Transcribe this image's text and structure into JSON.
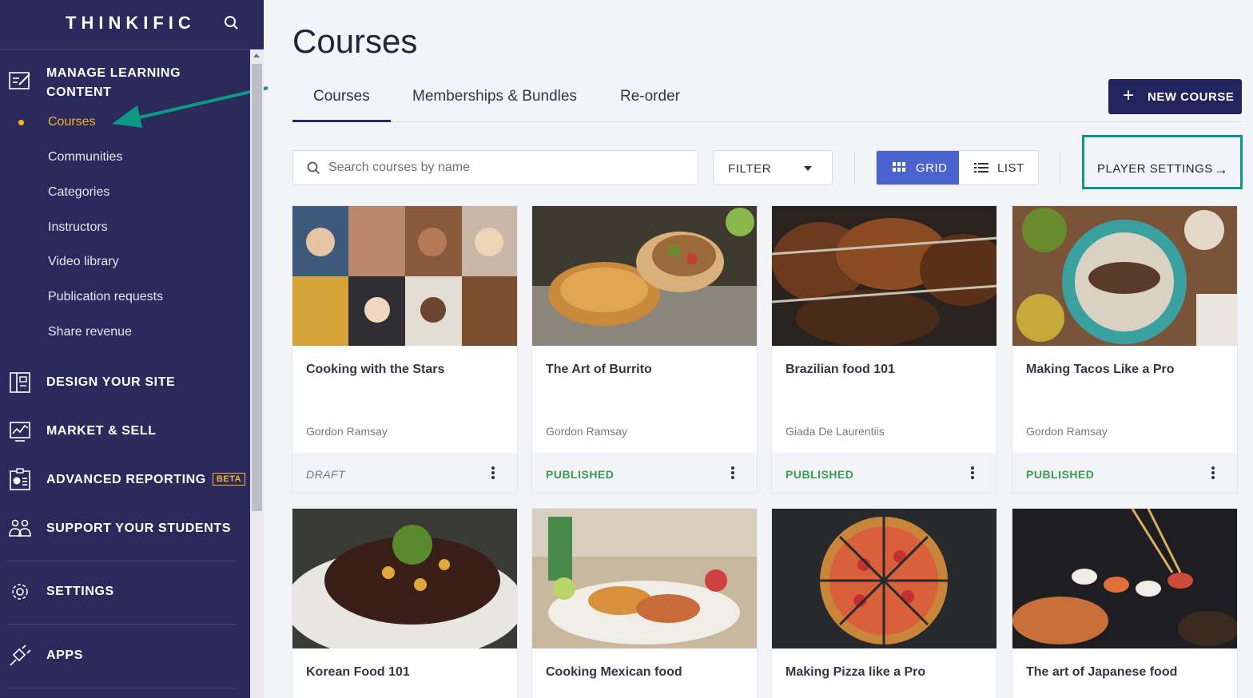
{
  "app": {
    "logo": "THINKIFIC"
  },
  "sidebar": {
    "manage_label": "MANAGE LEARNING CONTENT",
    "sub_items": [
      {
        "label": "Courses",
        "active": true
      },
      {
        "label": "Communities"
      },
      {
        "label": "Categories"
      },
      {
        "label": "Instructors"
      },
      {
        "label": "Video library"
      },
      {
        "label": "Publication requests"
      },
      {
        "label": "Share revenue"
      }
    ],
    "sections": [
      {
        "label": "DESIGN YOUR SITE",
        "icon": "layout-icon"
      },
      {
        "label": "MARKET & SELL",
        "icon": "chart-icon"
      },
      {
        "label": "ADVANCED REPORTING",
        "icon": "report-icon",
        "badge": "BETA"
      },
      {
        "label": "SUPPORT YOUR STUDENTS",
        "icon": "people-icon"
      },
      {
        "label": "SETTINGS",
        "icon": "gear-icon"
      },
      {
        "label": "APPS",
        "icon": "plug-icon"
      }
    ]
  },
  "main": {
    "title": "Courses",
    "tabs": [
      {
        "label": "Courses",
        "active": true
      },
      {
        "label": "Memberships & Bundles"
      },
      {
        "label": "Re-order"
      }
    ],
    "new_course_label": "NEW COURSE",
    "search": {
      "placeholder": "Search courses by name",
      "value": ""
    },
    "filter_label": "FILTER",
    "view": {
      "grid_label": "GRID",
      "list_label": "LIST",
      "selected": "GRID"
    },
    "player_settings_label": "PLAYER SETTINGS"
  },
  "courses": [
    {
      "title": "Cooking with the Stars",
      "author": "Gordon Ramsay",
      "status": "DRAFT"
    },
    {
      "title": "The Art of Burrito",
      "author": "Gordon Ramsay",
      "status": "PUBLISHED"
    },
    {
      "title": "Brazilian food 101",
      "author": "Giada De Laurentiis",
      "status": "PUBLISHED"
    },
    {
      "title": "Making Tacos Like a Pro",
      "author": "Gordon Ramsay",
      "status": "PUBLISHED"
    },
    {
      "title": "Korean Food 101"
    },
    {
      "title": "Cooking Mexican food"
    },
    {
      "title": "Making Pizza like a Pro"
    },
    {
      "title": "The art of Japanese food"
    }
  ],
  "colors": {
    "sidebar_bg": "#2b2a5c",
    "active_accent": "#f3b22d",
    "primary_button": "#23235e",
    "grid_toggle": "#4a63cf",
    "published": "#3b9a54",
    "highlight": "#0e9883"
  }
}
